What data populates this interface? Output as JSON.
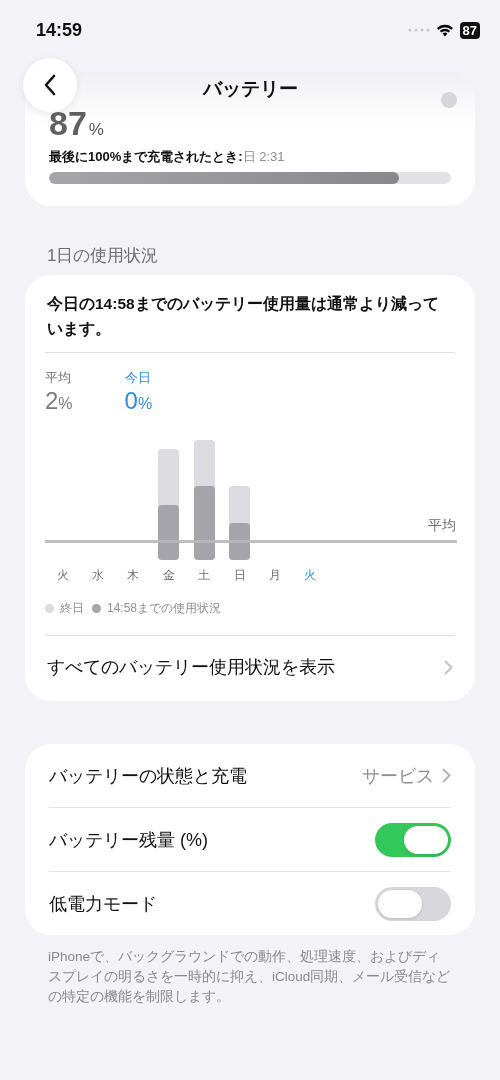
{
  "status_bar": {
    "time": "14:59",
    "battery": "87"
  },
  "nav": {
    "title": "バッテリー"
  },
  "battery_card": {
    "percent": "87",
    "unit": "%",
    "last_charged_label": "最後に100%まで充電されたとき:",
    "last_charged_value": "日 2:31",
    "level": 0.87
  },
  "usage_section": {
    "header": "1日の使用状況",
    "summary": "今日の14:58までのバッテリー使用量は通常より減っています。",
    "stats": [
      {
        "label": "平均",
        "value": "2",
        "unit": "%",
        "selected": false
      },
      {
        "label": "今日",
        "value": "0",
        "unit": "%",
        "selected": true
      }
    ],
    "average_label": "平均",
    "days": [
      {
        "label": "火",
        "selected": false
      },
      {
        "label": "水",
        "selected": false
      },
      {
        "label": "木",
        "selected": false
      },
      {
        "label": "金",
        "selected": false
      },
      {
        "label": "土",
        "selected": false
      },
      {
        "label": "日",
        "selected": false
      },
      {
        "label": "月",
        "selected": false
      },
      {
        "label": "火",
        "selected": true
      }
    ],
    "legend": [
      {
        "label": "終日",
        "color": "#dcdce0"
      },
      {
        "label": "14:58までの使用状況",
        "color": "#a4a4aa"
      }
    ],
    "link": "すべてのバッテリー使用状況を表示"
  },
  "settings": [
    {
      "kind": "link",
      "label": "バッテリーの状態と充電",
      "value": "サービス"
    },
    {
      "kind": "toggle",
      "label": "バッテリー残量 (%)",
      "on": true
    },
    {
      "kind": "toggle",
      "label": "低電力モード",
      "on": false
    }
  ],
  "footnote": "iPhoneで、バックグラウンドでの動作、処理速度、およびディスプレイの明るさを一時的に抑え、iCloud同期、メール受信などの特定の機能を制限します。"
}
